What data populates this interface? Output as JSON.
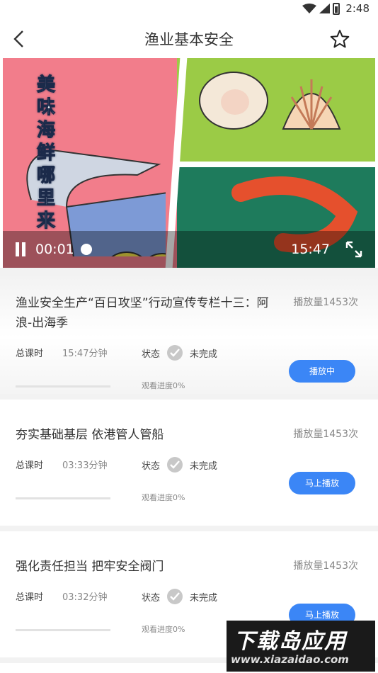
{
  "status_bar": {
    "time": "2:48"
  },
  "header": {
    "title": "渔业基本安全"
  },
  "video": {
    "poster_text": "美味海鲜哪里来",
    "current_time": "00:01",
    "duration": "15:47",
    "progress": 0.0
  },
  "lessons": [
    {
      "title": "渔业安全生产“百日攻坚”行动宣传专栏十三：阿浪-出海季",
      "plays": "播放量1453次",
      "duration_label": "总课时",
      "duration": "15:47分钟",
      "status_label": "状态",
      "status": "未完成",
      "progress_text": "观看进度0%",
      "progress": 0,
      "button": "播放中"
    },
    {
      "title": "夯实基础基层 依港管人管船",
      "plays": "播放量1453次",
      "duration_label": "总课时",
      "duration": "03:33分钟",
      "status_label": "状态",
      "status": "未完成",
      "progress_text": "观看进度0%",
      "progress": 0,
      "button": "马上播放"
    },
    {
      "title": "强化责任担当 把牢安全阀门",
      "plays": "播放量1453次",
      "duration_label": "总课时",
      "duration": "03:32分钟",
      "status_label": "状态",
      "status": "未完成",
      "progress_text": "观看进度0%",
      "progress": 0,
      "button": "马上播放"
    }
  ],
  "watermark": {
    "main": "下载岛应用",
    "url": "www.xiazaidao.com"
  },
  "colors": {
    "accent": "#3b86f6",
    "check_gray": "#c8c8c8"
  }
}
